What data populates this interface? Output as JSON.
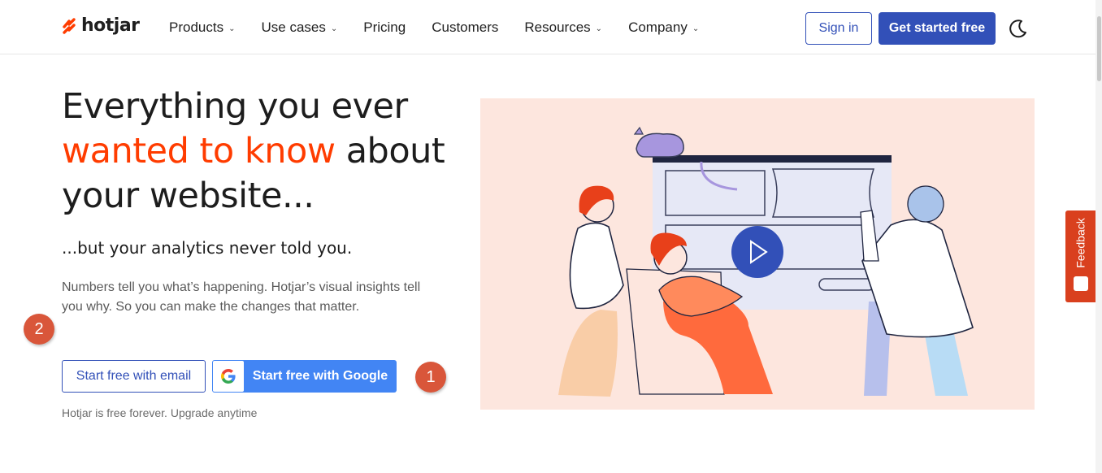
{
  "brand": {
    "name": "hotjar",
    "accent": "#ff3c00",
    "primary": "#3250b8"
  },
  "nav": {
    "items": [
      {
        "label": "Products",
        "dropdown": true
      },
      {
        "label": "Use cases",
        "dropdown": true
      },
      {
        "label": "Pricing",
        "dropdown": false
      },
      {
        "label": "Customers",
        "dropdown": false
      },
      {
        "label": "Resources",
        "dropdown": true
      },
      {
        "label": "Company",
        "dropdown": true
      }
    ],
    "sign_in": "Sign in",
    "get_started": "Get started free",
    "theme_icon": "moon-icon"
  },
  "hero": {
    "headline_line1": "Everything you ever",
    "headline_accent": "wanted to know",
    "headline_rest1": " about",
    "headline_line3": "your website...",
    "subhead": "...but your analytics never told you.",
    "body": "Numbers tell you what’s happening. Hotjar’s visual insights tell you why. So you can make the changes that matter.",
    "btn_email": "Start free with email",
    "btn_google": "Start free with Google",
    "footnote": "Hotjar is free forever. Upgrade anytime",
    "play_icon": "play-icon"
  },
  "annotations": {
    "badge_1": "1",
    "badge_2": "2"
  },
  "feedback": {
    "label": "Feedback"
  }
}
